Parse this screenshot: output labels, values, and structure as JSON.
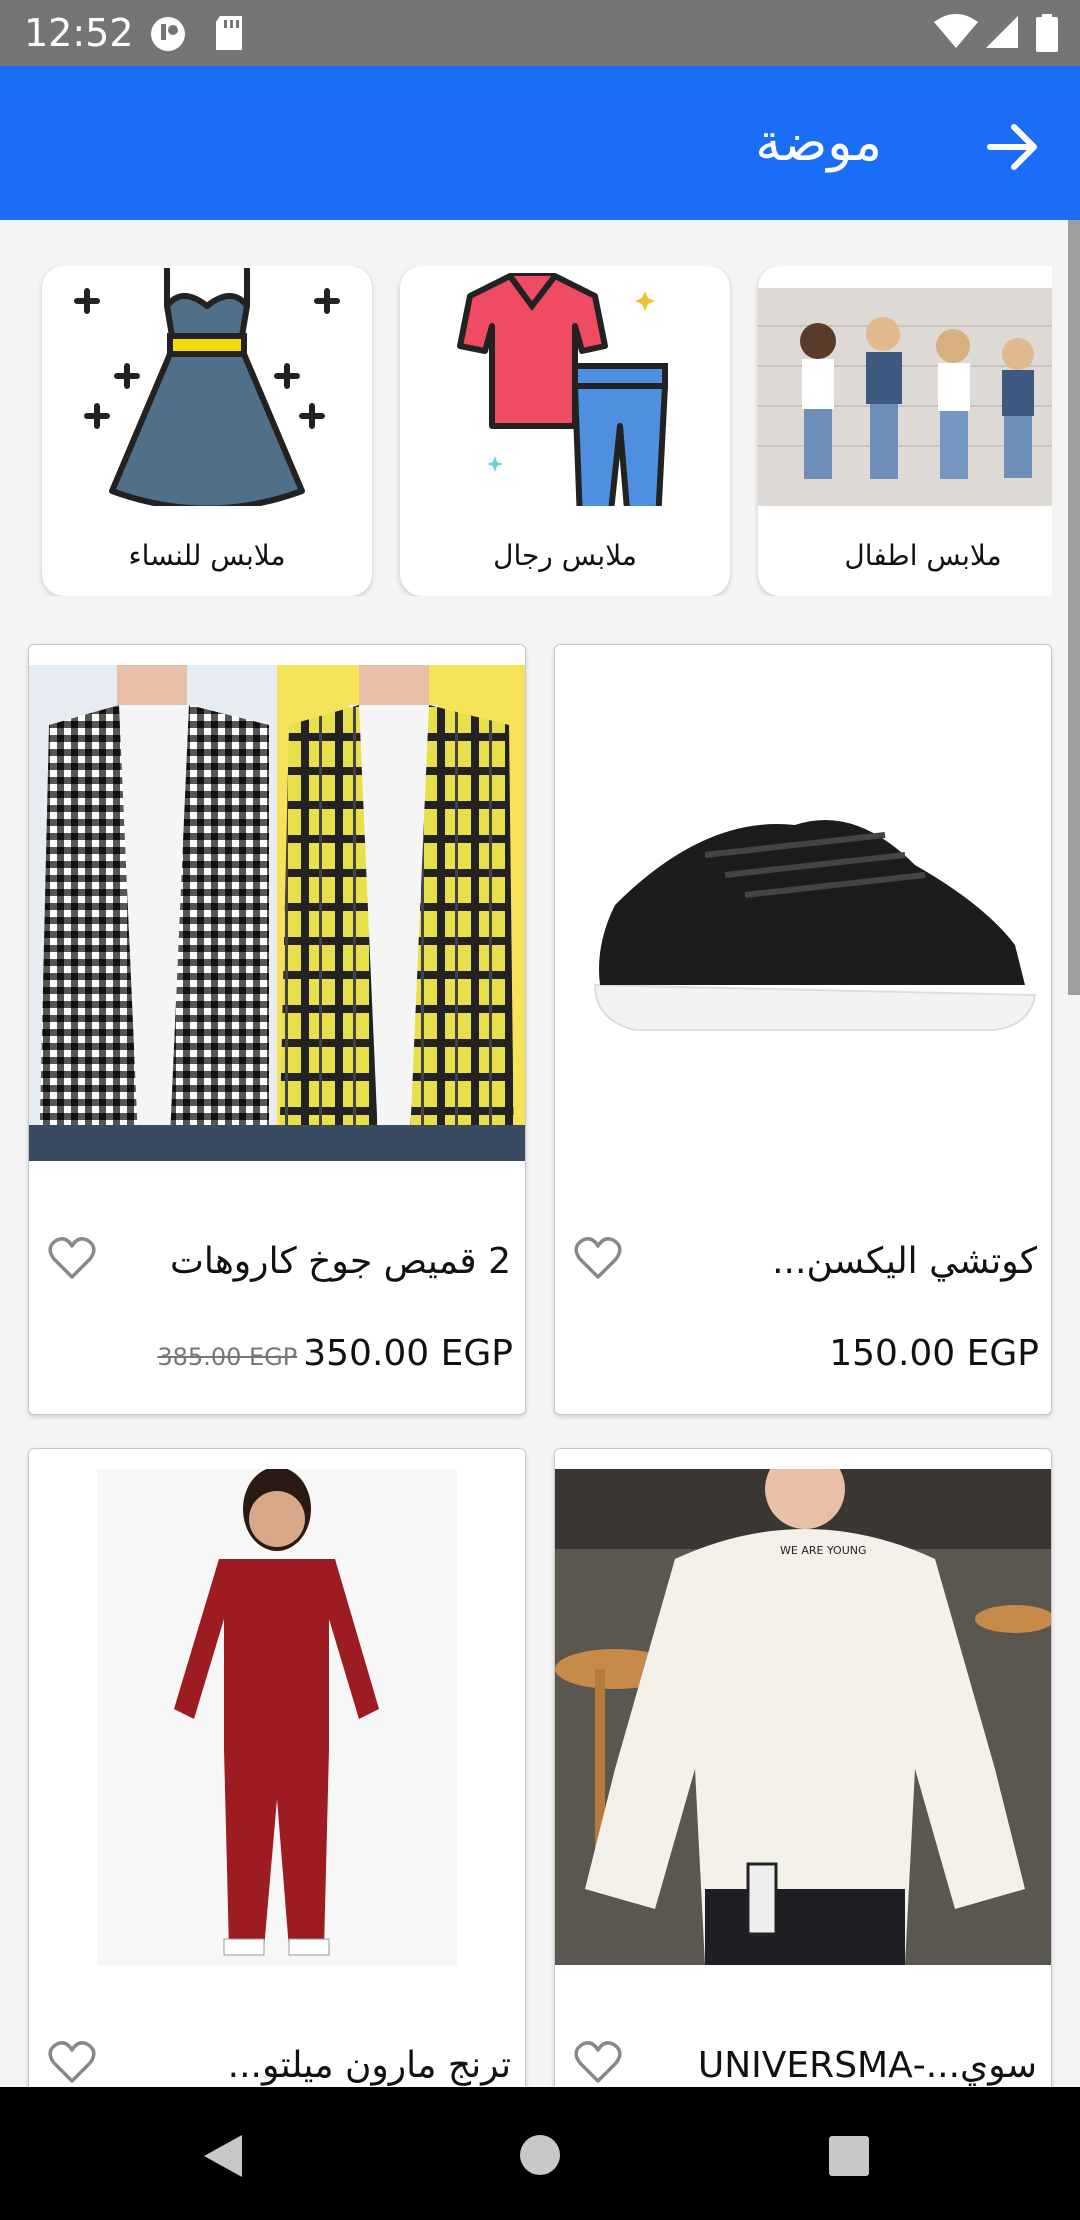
{
  "status_bar": {
    "time": "12:52",
    "icons": [
      "app-icon",
      "sd-card-icon",
      "wifi-icon",
      "signal-icon",
      "battery-icon"
    ]
  },
  "app_bar": {
    "title": "موضة",
    "back_icon": "arrow-right-icon",
    "color": "#1a6ef5"
  },
  "categories": [
    {
      "label": "ملابس اطفال",
      "image": "kids-photo"
    },
    {
      "label": "ملابس رجال",
      "image": "shirt-pants-icon"
    },
    {
      "label": "ملابس للنساء",
      "image": "dress-icon"
    }
  ],
  "products": [
    {
      "name": "كوتشي اليكسن...",
      "price": "150.00 EGP",
      "old_price": "",
      "image": "black-sneaker"
    },
    {
      "name": "2 قميص جوخ كاروهات",
      "price": "350.00 EGP",
      "old_price": "385.00 EGP",
      "image": "checkered-shirts"
    },
    {
      "name": "سوي...-UNIVERSMA",
      "price": "",
      "old_price": "",
      "image": "white-sweatshirt"
    },
    {
      "name": "ترنج مارون ميلتو...",
      "price": "",
      "old_price": "",
      "image": "maroon-tracksuit"
    }
  ],
  "nav_bar": {
    "buttons": [
      "back-triangle-icon",
      "home-circle-icon",
      "recents-square-icon"
    ]
  }
}
